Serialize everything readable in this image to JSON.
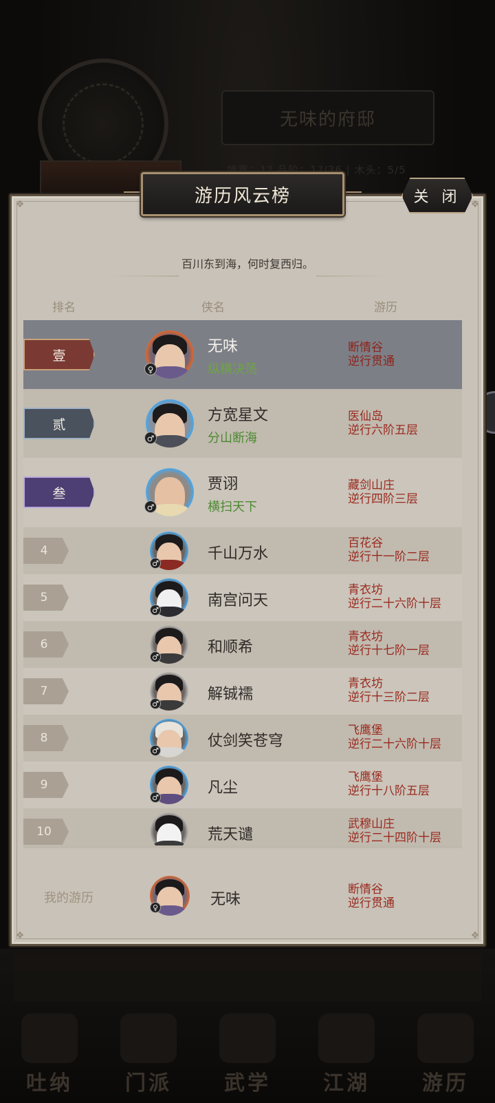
{
  "background": {
    "mansion_name": "无味的府邸",
    "stats": "境界：1?  品阶：1?/36  |  木头：5/5",
    "tabs": [
      "吐纳",
      "门派",
      "武学",
      "江湖",
      "游历"
    ]
  },
  "panel": {
    "title": "游历风云榜",
    "close_label": "关 闭",
    "motto": "百川东到海，何时复西归。",
    "columns": {
      "rank": "排名",
      "name": "侠名",
      "travel": "游历"
    }
  },
  "top_entries": [
    {
      "rank": "壹",
      "name": "无味",
      "title": "纵横决荡",
      "location": "断情谷",
      "progress": "逆行贯通",
      "gender": "♀"
    },
    {
      "rank": "贰",
      "name": "方宽星文",
      "title": "分山断海",
      "location": "医仙岛",
      "progress": "逆行六阶五层",
      "gender": "♂"
    },
    {
      "rank": "叁",
      "name": "贾诩",
      "title": "横扫天下",
      "location": "藏剑山庄",
      "progress": "逆行四阶三层",
      "gender": "♂"
    }
  ],
  "entries": [
    {
      "rank": "4",
      "name": "千山万水",
      "location": "百花谷",
      "progress": "逆行十一阶二层",
      "gender": "♂"
    },
    {
      "rank": "5",
      "name": "南宫问天",
      "location": "青衣坊",
      "progress": "逆行二十六阶十层",
      "gender": "♂"
    },
    {
      "rank": "6",
      "name": "和顺希",
      "location": "青衣坊",
      "progress": "逆行十七阶一层",
      "gender": "♂"
    },
    {
      "rank": "7",
      "name": "解铖襦",
      "location": "青衣坊",
      "progress": "逆行十三阶二层",
      "gender": "♂"
    },
    {
      "rank": "8",
      "name": "仗剑笑苍穹",
      "location": "飞鹰堡",
      "progress": "逆行二十六阶十层",
      "gender": "♂"
    },
    {
      "rank": "9",
      "name": "凡尘",
      "location": "飞鹰堡",
      "progress": "逆行十八阶五层",
      "gender": "♂"
    },
    {
      "rank": "10",
      "name": "荒天谴",
      "location": "武穆山庄",
      "progress": "逆行二十四阶十层",
      "gender": "♂"
    }
  ],
  "mine": {
    "label": "我的游历",
    "name": "无味",
    "location": "断情谷",
    "progress": "逆行贯通",
    "gender": "♀"
  },
  "colors": {
    "rank1": "#7a3a33",
    "rank2": "#4a525e",
    "rank3": "#4d3f73",
    "highlight_row": "#7d7f87",
    "travel_text": "#9a2a1f",
    "title_text": "#4c8a30"
  }
}
